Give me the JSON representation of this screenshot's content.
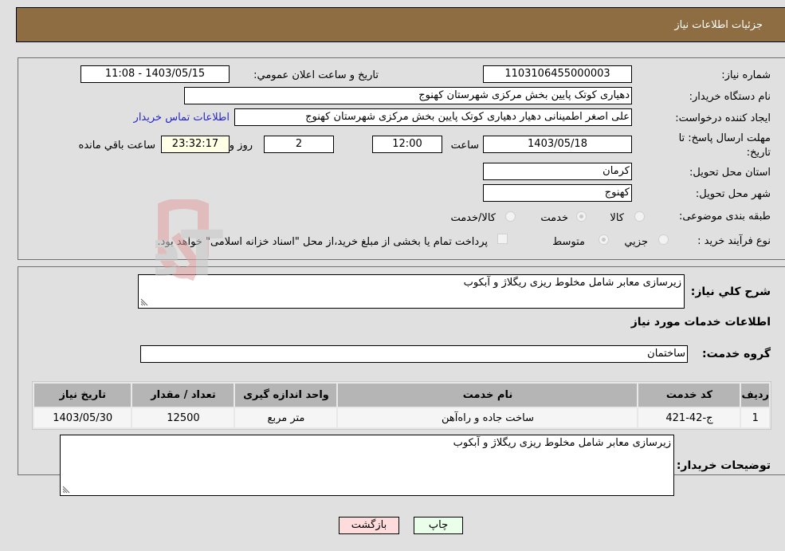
{
  "header": {
    "title": "جزئیات اطلاعات نیاز"
  },
  "form": {
    "need_number": {
      "label": "شماره نیاز:",
      "value": "1103106455000003"
    },
    "announce_datetime": {
      "label": "تاریخ و ساعت اعلان عمومي:",
      "value": "1403/05/15 - 11:08"
    },
    "buyer_org": {
      "label": "نام دستگاه خریدار:",
      "value": "دهیاری کوتک پایین بخش مرکزی شهرستان کهنوج"
    },
    "requester": {
      "label": "ایجاد کننده درخواست:",
      "value": "علی اصغر اطمینانی دهیار دهیاری کوتک پایین بخش مرکزی شهرستان کهنوج"
    },
    "contact_link": "اطلاعات تماس خریدار",
    "deadline": {
      "label_line1": "مهلت ارسال پاسخ: تا",
      "label_line2": "تاریخ:",
      "date": "1403/05/18",
      "time_label": "ساعت",
      "time": "12:00",
      "days": "2",
      "days_label": "روز و",
      "remaining": "23:32:17",
      "remaining_label": "ساعت باقي مانده"
    },
    "province": {
      "label": "استان محل تحویل:",
      "value": "کرمان"
    },
    "city": {
      "label": "شهر محل تحویل:",
      "value": "کهنوج"
    },
    "category": {
      "label": "طبقه بندی موضوعی:",
      "options": [
        "کالا",
        "خدمت",
        "کالا/خدمت"
      ],
      "selected": "خدمت"
    },
    "purchase_type": {
      "label": "نوع فرآیند خرید :",
      "options": [
        "جزیي",
        "متوسط"
      ],
      "selected": "متوسط",
      "treasury_note": "پرداخت تمام یا بخشی از مبلغ خرید،از محل \"اسناد خزانه اسلامی\" خواهد بود.",
      "treasury_checked": false
    }
  },
  "details": {
    "description_label": "شرح کلي نیاز:",
    "description": "زیرسازی معابر شامل مخلوط ریزی ریگلاژ و آبکوب",
    "services_heading": "اطلاعات خدمات مورد نیاز",
    "service_group_label": "گروه خدمت:",
    "service_group": "ساختمان",
    "table": {
      "headers": [
        "ردیف",
        "کد خدمت",
        "نام خدمت",
        "واحد اندازه گیری",
        "تعداد / مقدار",
        "تاریخ نیاز"
      ],
      "rows": [
        [
          "1",
          "ج-42-421",
          "ساخت جاده و راه‌آهن",
          "متر مربع",
          "12500",
          "1403/05/30"
        ]
      ]
    },
    "buyer_notes_label": "توضیحات خریدار:",
    "buyer_notes": "زیرسازی معابر شامل مخلوط ریزی ریگلاژ و آبکوب"
  },
  "buttons": {
    "print": "چاپ",
    "back": "بازگشت"
  },
  "watermark": "AriaTender.neT"
}
